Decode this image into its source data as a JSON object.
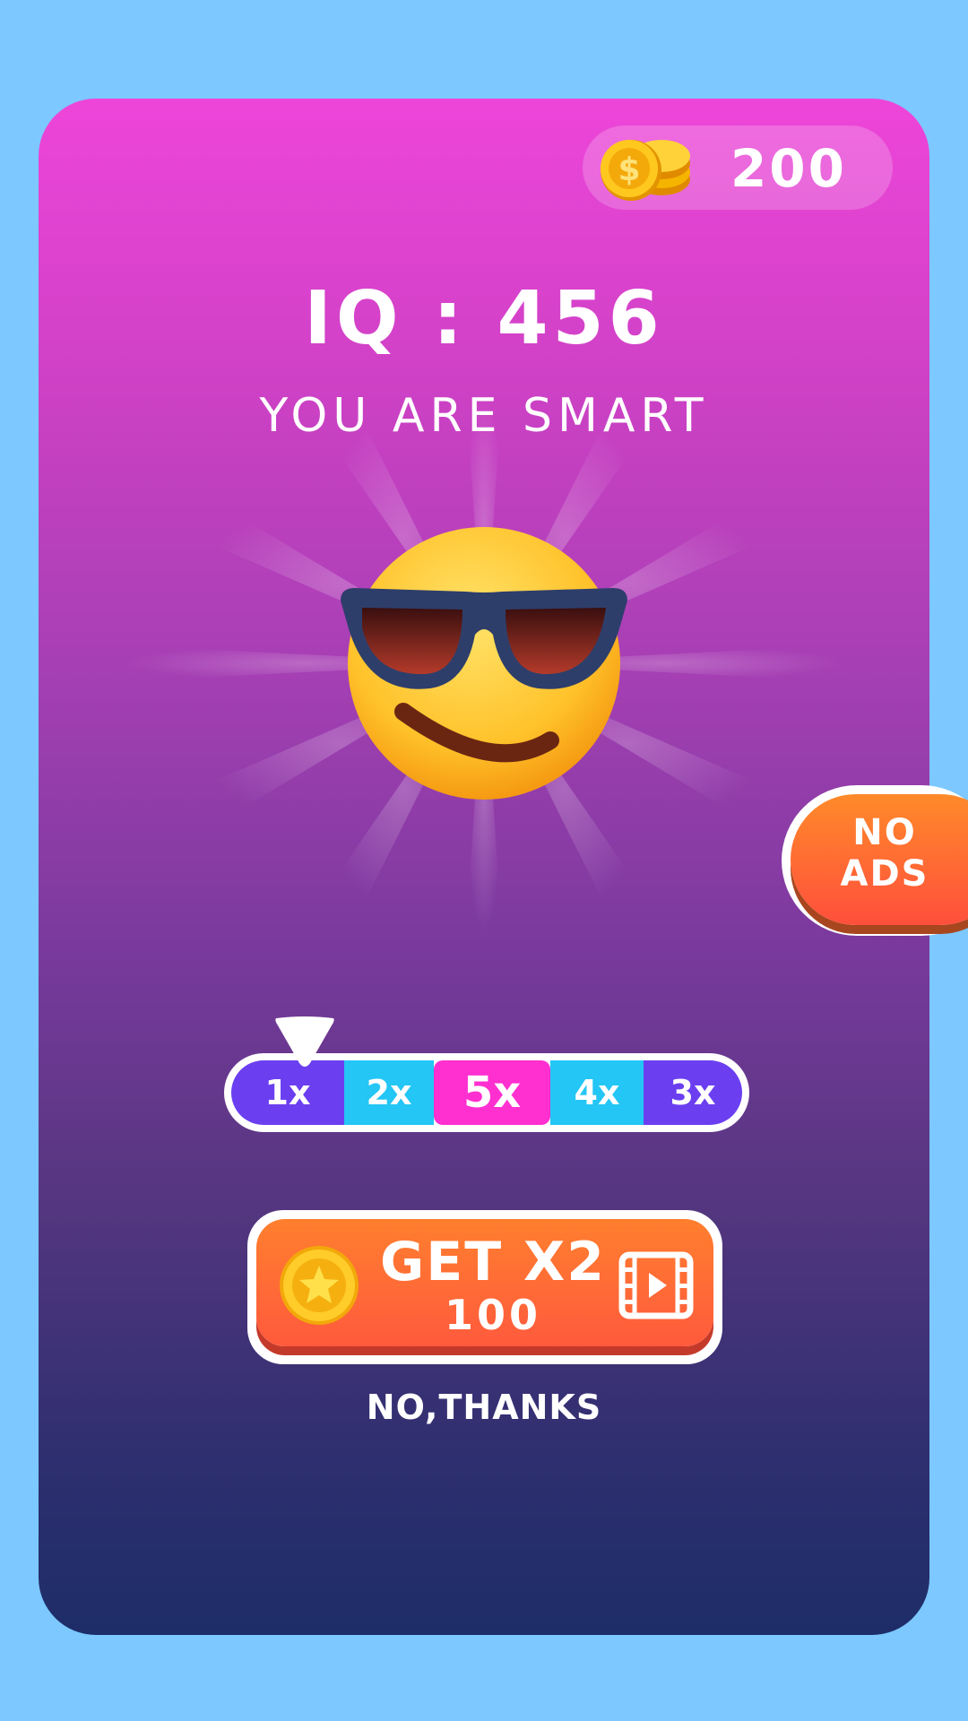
{
  "wallet": {
    "coins": "200",
    "coin_icon": "coin-stack-icon"
  },
  "result": {
    "iq_label": "IQ : 456",
    "message": "YOU ARE SMART",
    "emoji": "smiling-face-with-sunglasses"
  },
  "no_ads": {
    "label_line1": "NO",
    "label_line2": "ADS"
  },
  "multiplier": {
    "segments": [
      {
        "label": "1x",
        "color": "#6b3ff0"
      },
      {
        "label": "2x",
        "color": "#23c6f5"
      },
      {
        "label": "5x",
        "color": "#ff2fd0"
      },
      {
        "label": "4x",
        "color": "#23c6f5"
      },
      {
        "label": "3x",
        "color": "#6b3ff0"
      }
    ],
    "pointer_on": "1x"
  },
  "reward_button": {
    "title": "GET X2",
    "cost": "100",
    "left_icon": "star-coin-icon",
    "right_icon": "video-film-icon"
  },
  "decline": {
    "label": "NO,THANKS"
  },
  "colors": {
    "background": "#7cc8ff",
    "card_top": "#ee45d9",
    "card_bottom": "#1d2d68",
    "button_orange": "#ff6a35"
  }
}
